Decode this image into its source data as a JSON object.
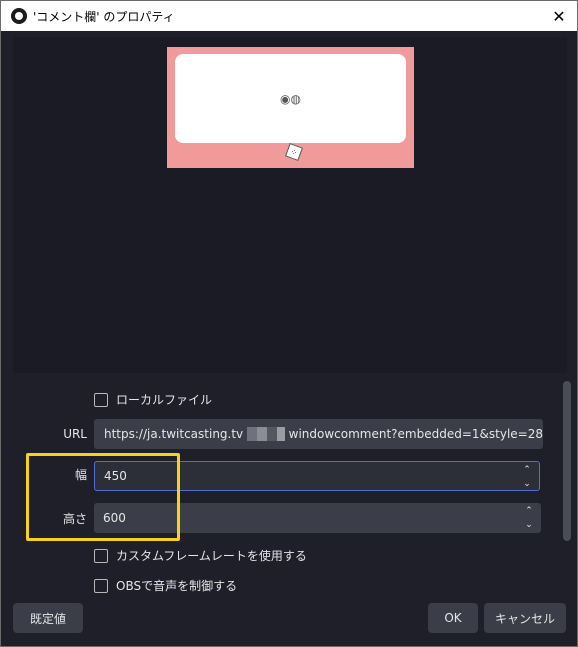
{
  "window": {
    "title": "'コメント欄' のプロパティ",
    "close_glyph": "✕"
  },
  "preview": {
    "card_glyph": "◉◍",
    "dice_glyph": "⁘"
  },
  "properties": {
    "local_file_label": "ローカルファイル",
    "url_label": "URL",
    "url_value_prefix": "https://ja.twitcasting.tv",
    "url_value_suffix": "windowcomment?embedded=1&style=28",
    "width_label": "幅",
    "width_value": "450",
    "height_label": "高さ",
    "height_value": "600",
    "custom_framerate_label": "カスタムフレームレートを使用する",
    "obs_audio_label": "OBSで音声を制御する"
  },
  "spin_arrows": {
    "up": "⌃",
    "down": "⌄"
  },
  "buttons": {
    "defaults": "既定値",
    "ok": "OK",
    "cancel": "キャンセル"
  },
  "colors": {
    "background": "#1e1f29",
    "field": "#3b3d48",
    "focus": "#4f6fd6",
    "highlight": "#f5d21e",
    "preview_bg": "#f09a9a"
  }
}
